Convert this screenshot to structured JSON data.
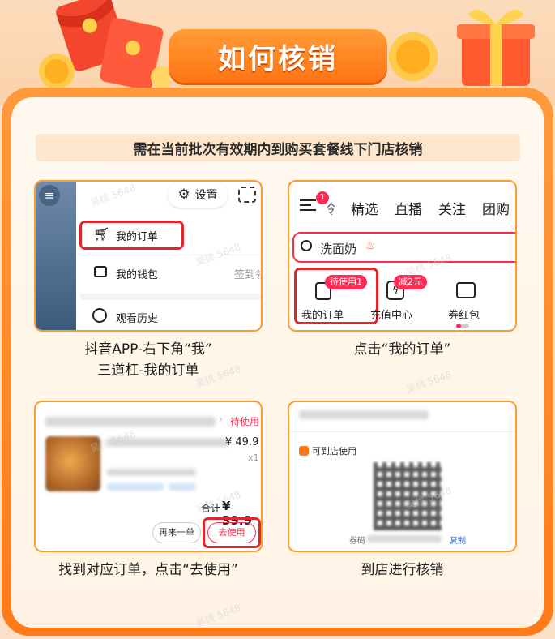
{
  "title": "如何核销",
  "requirement": "需在当前批次有效期内到购买套餐线下门店核销",
  "steps": [
    {
      "caption_line1": "抖音APP-右下角“我”",
      "caption_line2": "三道杠-我的订单"
    },
    {
      "caption_line1": "点击“我的订单”"
    },
    {
      "caption_line1": "找到对应订单，点击“去使用”"
    },
    {
      "caption_line1": "到店进行核销"
    }
  ],
  "card1": {
    "settings_label": "设置",
    "menu": [
      {
        "label": "我的订单",
        "icon": "cart-icon"
      },
      {
        "label": "我的钱包",
        "icon": "wallet-icon",
        "side": "签到领"
      },
      {
        "label": "观看历史",
        "icon": "clock-icon"
      }
    ]
  },
  "card2": {
    "badge_count": "1",
    "tabs": [
      "邻",
      "精选",
      "直播",
      "关注",
      "团购"
    ],
    "search_value": "洗面奶",
    "shortcuts": [
      {
        "label": "我的订单",
        "badge": "待使用1",
        "icon": "order-icon"
      },
      {
        "label": "充值中心",
        "badge": "减2元",
        "icon": "lightning-icon"
      },
      {
        "label": "券红包",
        "icon": "ticket-icon"
      }
    ]
  },
  "card3": {
    "status": "待使用",
    "price": "¥ 49.9",
    "qty": "x1",
    "total_label": "合计",
    "total_value": "¥ 39.9",
    "rebuy_button": "再来一单",
    "use_button": "去使用"
  },
  "card4": {
    "store_use": "可到店使用",
    "code_label": "券码",
    "copy_label": "复制"
  },
  "watermark": "吴桃 5648",
  "colors": {
    "accent": "#ff7a18",
    "frame": "#ff9a2e",
    "highlight": "#e3262c",
    "badge": "#fe2c55"
  }
}
